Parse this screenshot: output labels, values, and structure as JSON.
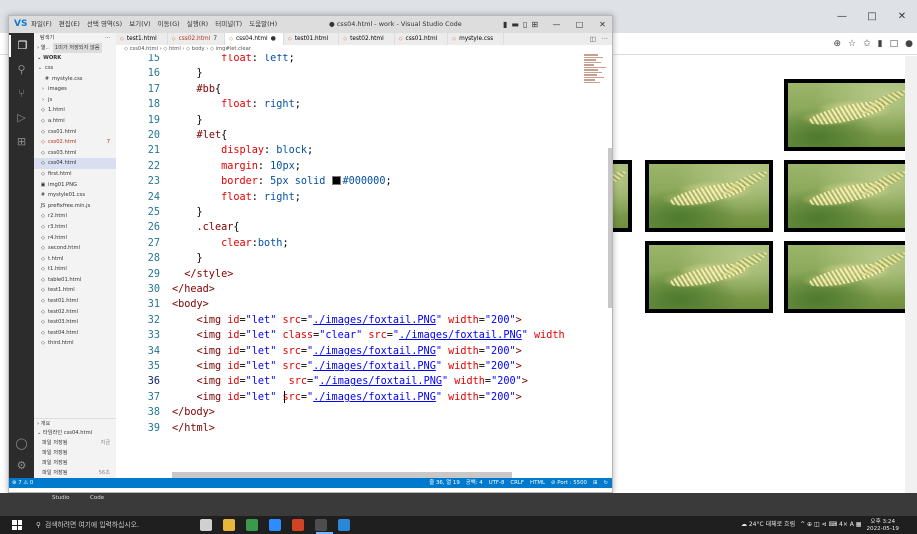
{
  "vscode": {
    "logo": "VS",
    "menus": [
      "파일(F)",
      "편집(E)",
      "선택 영역(S)",
      "보기(V)",
      "이동(G)",
      "실행(R)",
      "터미널(T)",
      "도움말(H)"
    ],
    "window_title": "● css04.html - work - Visual Studio Code",
    "window_controls": [
      "—",
      "□",
      "✕"
    ],
    "sidebar": {
      "title": "탐색기",
      "more": "···",
      "open_editors_label": "› 열..",
      "open_editors_note": "1미가 저장되지 않음",
      "workspace": "⌄ WORK",
      "items": [
        {
          "name": "css",
          "icon": "⌄",
          "badge": ""
        },
        {
          "name": "mystyle.css",
          "icon": "#",
          "badge": ""
        },
        {
          "name": "images",
          "icon": "›",
          "badge": ""
        },
        {
          "name": "js",
          "icon": "›",
          "badge": ""
        },
        {
          "name": "1.html",
          "icon": "◇",
          "badge": ""
        },
        {
          "name": "a.html",
          "icon": "◇",
          "badge": ""
        },
        {
          "name": "css01.html",
          "icon": "◇",
          "badge": ""
        },
        {
          "name": "css02.html",
          "icon": "◇",
          "badge": "7"
        },
        {
          "name": "css03.html",
          "icon": "◇",
          "badge": ""
        },
        {
          "name": "css04.html",
          "icon": "◇",
          "badge": ""
        },
        {
          "name": "first.html",
          "icon": "◇",
          "badge": ""
        },
        {
          "name": "img01.PNG",
          "icon": "▣",
          "badge": ""
        },
        {
          "name": "mystyle01.css",
          "icon": "#",
          "badge": ""
        },
        {
          "name": "prefixfree.min.js",
          "icon": "JS",
          "badge": ""
        },
        {
          "name": "r2.html",
          "icon": "◇",
          "badge": ""
        },
        {
          "name": "r3.html",
          "icon": "◇",
          "badge": ""
        },
        {
          "name": "r4.html",
          "icon": "◇",
          "badge": ""
        },
        {
          "name": "second.html",
          "icon": "◇",
          "badge": ""
        },
        {
          "name": "t.html",
          "icon": "◇",
          "badge": ""
        },
        {
          "name": "t1.html",
          "icon": "◇",
          "badge": ""
        },
        {
          "name": "table01.html",
          "icon": "◇",
          "badge": ""
        },
        {
          "name": "test1.html",
          "icon": "◇",
          "badge": ""
        },
        {
          "name": "test01.html",
          "icon": "◇",
          "badge": ""
        },
        {
          "name": "test02.html",
          "icon": "◇",
          "badge": ""
        },
        {
          "name": "test03.html",
          "icon": "◇",
          "badge": ""
        },
        {
          "name": "test04.html",
          "icon": "◇",
          "badge": ""
        },
        {
          "name": "third.html",
          "icon": "◇",
          "badge": ""
        }
      ],
      "outline": "› 개요",
      "timeline": "⌄ 타임라인  css04.html",
      "timeline_items": [
        {
          "label": "파일 저장됨",
          "time": "지금"
        },
        {
          "label": "파일 저장됨",
          "time": ""
        },
        {
          "label": "파일 저장됨",
          "time": ""
        },
        {
          "label": "파일 저장됨",
          "time": "56초"
        },
        {
          "label": "파일 저장됨",
          "time": "1분"
        },
        {
          "label": "파일 저장됨",
          "time": ""
        }
      ]
    },
    "tabs": [
      {
        "label": "test1.html",
        "badge": "",
        "modified": false,
        "active": false
      },
      {
        "label": "css02.html",
        "badge": "7",
        "modified": true,
        "active": false
      },
      {
        "label": "css04.html",
        "badge": "●",
        "modified": false,
        "active": true
      },
      {
        "label": "test01.html",
        "badge": "",
        "modified": false,
        "active": false
      },
      {
        "label": "test02.html",
        "badge": "",
        "modified": false,
        "active": false
      },
      {
        "label": "css01.html",
        "badge": "",
        "modified": false,
        "active": false
      },
      {
        "label": "mystyle.css",
        "badge": "",
        "modified": false,
        "active": false
      }
    ],
    "tab_actions": [
      "◫",
      "···"
    ],
    "breadcrumb": "◇ css04.html › ◇ html › ◇ body › ◇ img#let.clear",
    "code_lines": [
      {
        "n": "15",
        "html": "        <span class='t-prop'>float</span>: <span class='t-val'>left</span>;"
      },
      {
        "n": "16",
        "html": "    }"
      },
      {
        "n": "17",
        "html": "    <span class='t-sel'>#bb</span>{"
      },
      {
        "n": "18",
        "html": "        <span class='t-prop'>float</span>: <span class='t-val'>right</span>;"
      },
      {
        "n": "19",
        "html": "    }"
      },
      {
        "n": "20",
        "html": "    <span class='t-sel'>#let</span>{"
      },
      {
        "n": "21",
        "html": "        <span class='t-prop'>display</span>: <span class='t-val'>block</span>;"
      },
      {
        "n": "22",
        "html": "        <span class='t-prop'>margin</span>: <span class='t-val'>10px</span>;"
      },
      {
        "n": "23",
        "html": "        <span class='t-prop'>border</span>: <span class='t-val'>5px solid</span> <span class='swatch'></span><span class='t-val'>#000000</span>;"
      },
      {
        "n": "24",
        "html": "        <span class='t-prop'>float</span>: <span class='t-val'>right</span>;"
      },
      {
        "n": "25",
        "html": "    }"
      },
      {
        "n": "26",
        "html": "    <span class='t-sel'>.clear</span>{"
      },
      {
        "n": "27",
        "html": "        <span class='t-prop'>clear</span>:<span class='t-val'>both</span>;"
      },
      {
        "n": "28",
        "html": "    }"
      },
      {
        "n": "29",
        "html": "<span class='t-tag'>  &lt;/style&gt;</span>"
      },
      {
        "n": "30",
        "html": "<span class='t-tag'>&lt;/head&gt;</span>"
      },
      {
        "n": "31",
        "html": "<span class='t-tag'>&lt;body&gt;</span>"
      },
      {
        "n": "32",
        "html": "    <span class='t-tag'>&lt;img</span> <span class='t-at'>id</span>=<span class='t-str'>\"let\"</span> <span class='t-at'>src</span>=<span class='t-str'>\"<span class='t-url'>./images/foxtail.PNG</span>\"</span> <span class='t-at'>width</span>=<span class='t-str'>\"200\"</span><span class='t-tag'>&gt;</span>"
      },
      {
        "n": "33",
        "html": "    <span class='t-tag'>&lt;img</span> <span class='t-at'>id</span>=<span class='t-str'>\"let\"</span> <span class='t-at'>class</span>=<span class='t-str'>\"clear\"</span> <span class='t-at'>src</span>=<span class='t-str'>\"<span class='t-url'>./images/foxtail.PNG</span>\"</span> <span class='t-at'>width</span>"
      },
      {
        "n": "34",
        "html": "    <span class='t-tag'>&lt;img</span> <span class='t-at'>id</span>=<span class='t-str'>\"let\"</span> <span class='t-at'>src</span>=<span class='t-str'>\"<span class='t-url'>./images/foxtail.PNG</span>\"</span> <span class='t-at'>width</span>=<span class='t-str'>\"200\"</span><span class='t-tag'>&gt;</span>"
      },
      {
        "n": "35",
        "html": "    <span class='t-tag'>&lt;img</span> <span class='t-at'>id</span>=<span class='t-str'>\"let\"</span> <span class='t-at'>src</span>=<span class='t-str'>\"<span class='t-url'>./images/foxtail.PNG</span>\"</span> <span class='t-at'>width</span>=<span class='t-str'>\"200\"</span><span class='t-tag'>&gt;</span>"
      },
      {
        "n": "36",
        "html": "    <span class='t-tag'>&lt;img</span> <span class='t-at'>id</span>=<span class='t-str'>\"let\"</span>  <span class='t-at'>src</span>=<span class='t-str'>\"<span class='t-url'>./images/foxtail.PNG</span>\"</span> <span class='t-at'>width</span>=<span class='t-str'>\"200\"</span><span class='t-tag'>&gt;</span>"
      },
      {
        "n": "37",
        "html": "    <span class='t-tag'>&lt;img</span> <span class='t-at'>id</span>=<span class='t-str'>\"let\"</span> <span class='t-at'>src</span>=<span class='t-str'>\"<span class='t-url'>./images/foxtail.PNG</span>\"</span> <span class='t-at'>width</span>=<span class='t-str'>\"200\"</span><span class='t-tag'>&gt;</span>"
      },
      {
        "n": "38",
        "html": "<span class='t-tag'>&lt;/body&gt;</span>"
      },
      {
        "n": "39",
        "html": "<span class='t-tag'>&lt;/html&gt;</span>"
      }
    ],
    "current_line": "36",
    "status_left": [
      "⊗ 7 ⚠ 0"
    ],
    "status_right": [
      "줄 36, 열 19",
      "공백: 4",
      "UTF-8",
      "CRLF",
      "HTML",
      "⊘ Port : 5500",
      "⊞",
      "↻"
    ]
  },
  "browser": {
    "window_controls": [
      "—",
      "□",
      "✕"
    ],
    "toolbar_icons": [
      "⊕",
      "☆",
      "✩",
      "▮",
      "□",
      "●"
    ],
    "images_alt": "foxtail"
  },
  "desktop": {
    "labels": [
      "Studio",
      "Code"
    ]
  },
  "taskbar": {
    "search_icon": "⚲",
    "search_placeholder": "검색하려면 여기에 입력하십시오.",
    "weather": "☁ 24°C 대체로 흐림",
    "tray_icons": "^ ⊕ ◫ ⊲ ⌨ 4× A ▦",
    "time": "오후 3:24",
    "date": "2022-05-19",
    "apps": [
      {
        "name": "task-view",
        "color": "#d0d0d0"
      },
      {
        "name": "file-explorer",
        "color": "#e8b73a"
      },
      {
        "name": "chrome",
        "color": "#3b9a4a"
      },
      {
        "name": "zoom",
        "color": "#2d8cff"
      },
      {
        "name": "powerpoint",
        "color": "#d04423"
      },
      {
        "name": "app-grey",
        "color": "#4d4d4d"
      },
      {
        "name": "vscode",
        "color": "#2a86d6"
      }
    ]
  }
}
